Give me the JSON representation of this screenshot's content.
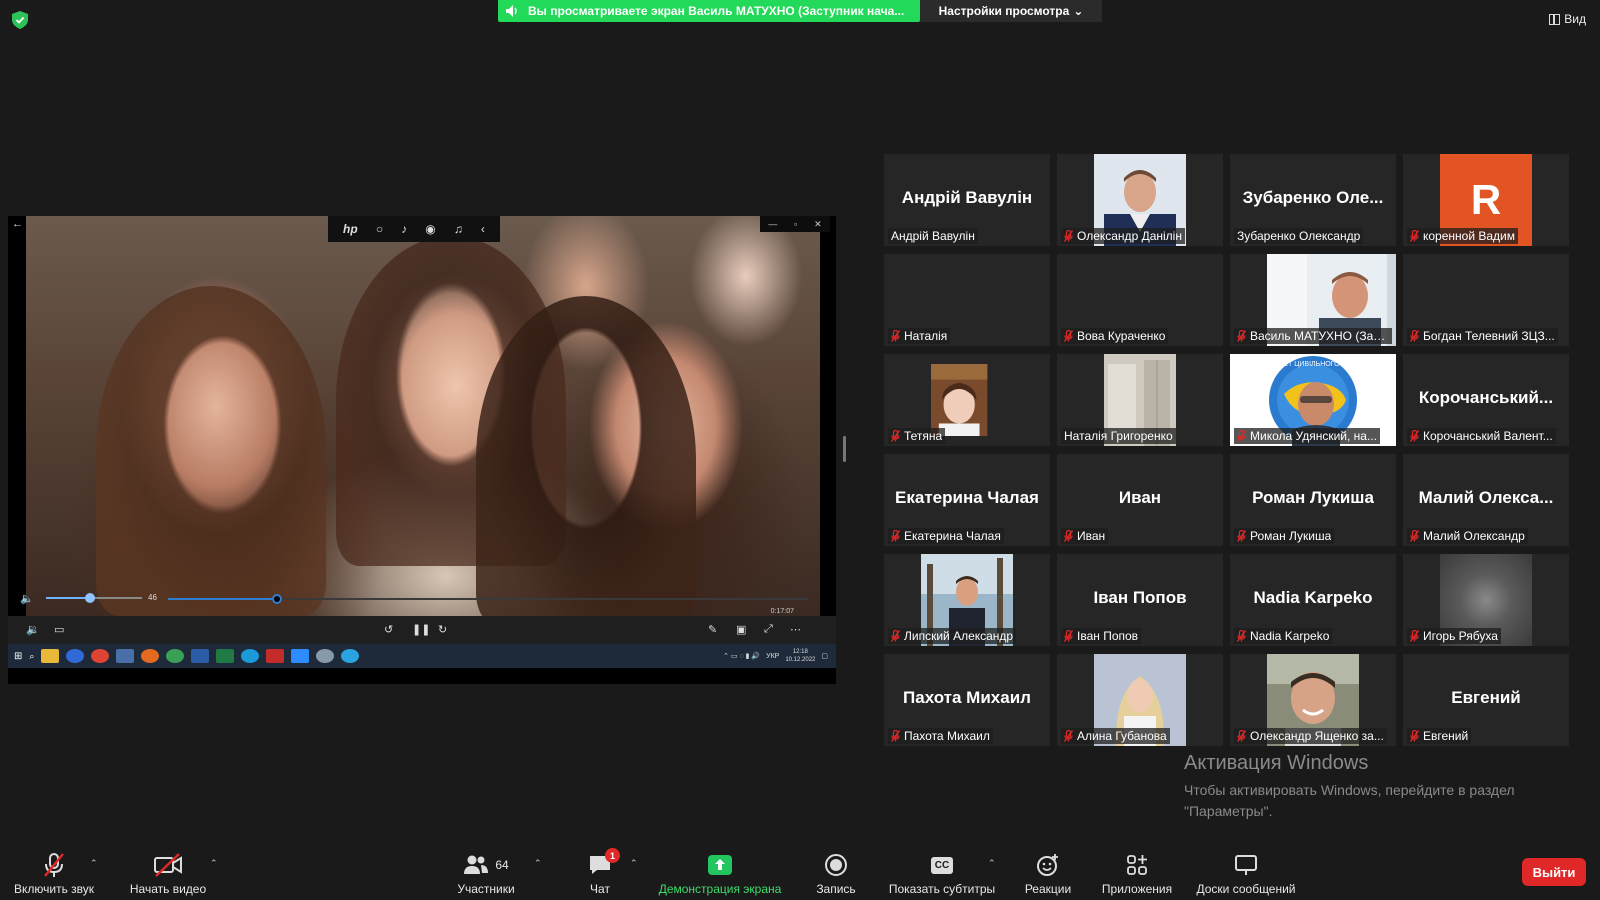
{
  "top": {
    "banner_text": "Вы просматриваете экран Василь МАТУХНО (Заступник нача...",
    "view_options": "Настройки просмотра",
    "view_label": "Вид"
  },
  "shared_screen": {
    "volume_value": "46",
    "volume_level": 0.46,
    "progress_level": 0.17,
    "elapsed_time": "0:17:07",
    "clock_time": "12:18",
    "clock_date": "10.12.2022",
    "lang": "УКР"
  },
  "participants": [
    {
      "big": "Андрій Вавулін",
      "label": "Андрій Вавулін",
      "muted": false,
      "video": "none"
    },
    {
      "big": "",
      "label": "Олександр Данілін",
      "muted": true,
      "video": "officer"
    },
    {
      "big": "Зубаренко Оле...",
      "label": "Зубаренко Олександр",
      "muted": false,
      "video": "none"
    },
    {
      "big": "",
      "label": "коренной Вадим",
      "muted": true,
      "video": "avatar-r",
      "avatar_letter": "R"
    },
    {
      "big": "",
      "label": "Наталія",
      "muted": true,
      "video": "none"
    },
    {
      "big": "",
      "label": "Вова Кураченко",
      "muted": true,
      "video": "none"
    },
    {
      "big": "",
      "label": "Василь МАТУХНО (Зас...",
      "muted": true,
      "video": "man-office"
    },
    {
      "big": "",
      "label": "Богдан Телевний ЗЦЗ...",
      "muted": true,
      "video": "none"
    },
    {
      "big": "",
      "label": "Тетяна",
      "muted": true,
      "video": "woman"
    },
    {
      "big": "",
      "label": "Наталія Григоренко",
      "muted": false,
      "video": "room"
    },
    {
      "big": "",
      "label": "Микола Удянский, на...",
      "muted": true,
      "video": "logo",
      "logo_text": "ФАКУЛЬТЕТ ЦИВІЛЬНОГО ЗАХИСТУ"
    },
    {
      "big": "Корочанський...",
      "label": "Корочанський Валент...",
      "muted": true,
      "video": "none"
    },
    {
      "big": "Екатерина Чалая",
      "label": "Екатерина Чалая",
      "muted": true,
      "video": "none"
    },
    {
      "big": "Иван",
      "label": "Иван",
      "muted": true,
      "video": "none"
    },
    {
      "big": "Роман Лукиша",
      "label": "Роман Лукиша",
      "muted": true,
      "video": "none"
    },
    {
      "big": "Малий Олекса...",
      "label": "Малий Олександр",
      "muted": true,
      "video": "none"
    },
    {
      "big": "",
      "label": "Липский Александр",
      "muted": true,
      "video": "man-outdoor"
    },
    {
      "big": "Іван Попов",
      "label": "Іван Попов",
      "muted": true,
      "video": "none"
    },
    {
      "big": "Nadia Karpeko",
      "label": "Nadia Karpeko",
      "muted": true,
      "video": "none"
    },
    {
      "big": "",
      "label": "Игорь Рябуха",
      "muted": true,
      "video": "blur"
    },
    {
      "big": "Пахота Михаил",
      "label": "Пахота Михаил",
      "muted": true,
      "video": "none"
    },
    {
      "big": "",
      "label": "Алина Губанова",
      "muted": true,
      "video": "blonde"
    },
    {
      "big": "",
      "label": "Олександр Ященко за...",
      "muted": true,
      "video": "man-smile"
    },
    {
      "big": "Евгений",
      "label": "Евгений",
      "muted": true,
      "video": "none"
    }
  ],
  "watermark": {
    "title": "Активация Windows",
    "line": "Чтобы активировать Windows, перейдите в раздел \"Параметры\"."
  },
  "toolbar": {
    "unmute": "Включить звук",
    "start_video": "Начать видео",
    "participants": "Участники",
    "participants_count": "64",
    "chat": "Чат",
    "chat_badge": "1",
    "share": "Демонстрация экрана",
    "record": "Запись",
    "captions": "Показать субтитры",
    "captions_icon": "CC",
    "reactions": "Реакции",
    "apps": "Приложения",
    "whiteboards": "Доски сообщений",
    "leave": "Выйти"
  },
  "colors": {
    "banner": "#23d959",
    "muted_icon": "#e02828",
    "leave": "#e02828",
    "tile_bg": "#262626"
  }
}
